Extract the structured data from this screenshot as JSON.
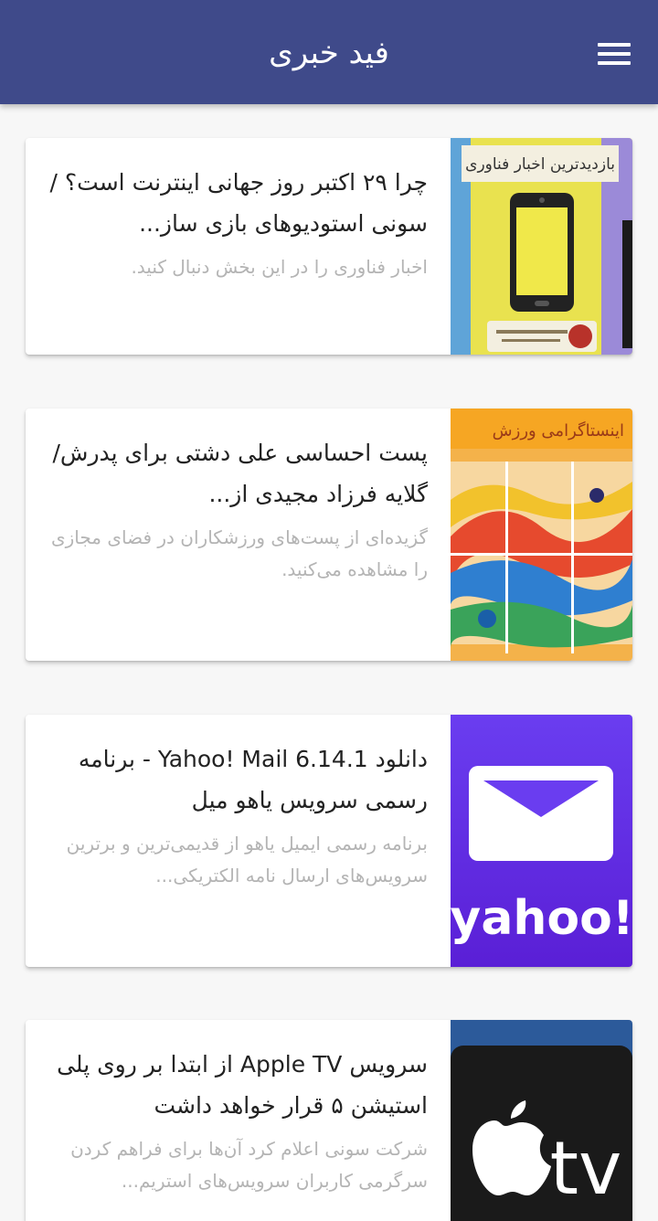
{
  "header": {
    "title": "فید خبری",
    "menu_icon": "hamburger-menu-icon",
    "background": "#3f4a8a"
  },
  "feed": {
    "items": [
      {
        "title": "چرا ۲۹ اکتبر روز جهانی اینترنت است؟ / سونی استودیوهای بازی ساز...",
        "description": "اخبار فناوری را در این بخش دنبال کنید.",
        "thumbnail_banner": "بازدیدترین اخبار فناوری"
      },
      {
        "title": "پست احساسی علی دشتی برای پدرش/ گلایه فرزاد مجیدی از...",
        "description": "گزیده‌ای از پست‌های ورزشکاران در فضای مجازی را مشاهده می‌کنید.",
        "thumbnail_banner": "اینستاگرامی ورزش"
      },
      {
        "title": "دانلود Yahoo! Mail 6.14.1 - برنامه رسمی سرویس یاهو میل",
        "description": "برنامه رسمی ایمیل یاهو از قدیمی‌ترین و برترین سرویس‌های ارسال نامه الکتریکی...",
        "thumbnail_text": "yahoo!"
      },
      {
        "title": "سرویس Apple TV از ابتدا بر روی پلی استیشن ۵ قرار خواهد داشت",
        "description": "شرکت سونی اعلام کرد آن‌ها برای فراهم کردن سرگرمی کاربران سرویس‌های استریم...",
        "thumbnail_text": "tv"
      }
    ]
  }
}
